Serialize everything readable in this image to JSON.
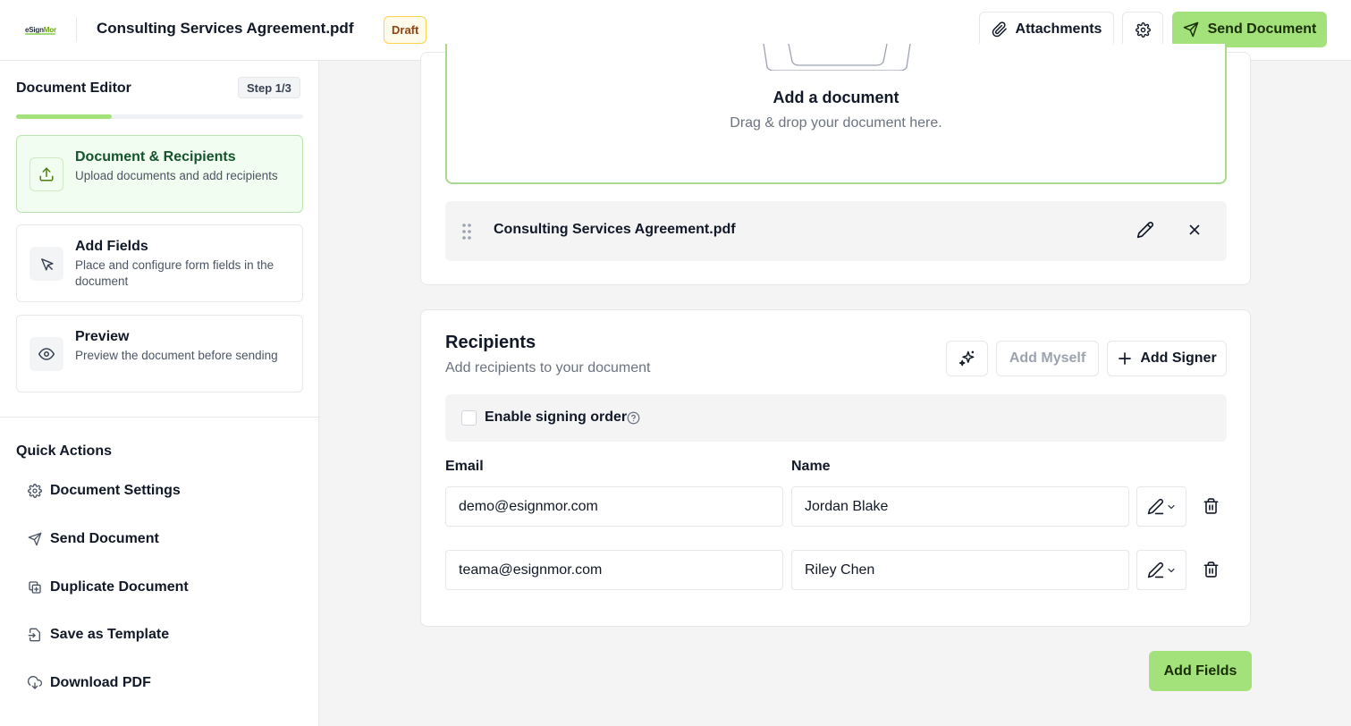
{
  "header": {
    "logo_prefix": "eSign",
    "logo_suffix": "Mor",
    "document_title": "Consulting Services Agreement.pdf",
    "status_badge": "Draft",
    "attachments_label": "Attachments",
    "send_label": "Send Document"
  },
  "sidebar": {
    "title": "Document Editor",
    "step_indicator": "Step 1/3",
    "progress_fraction": 0.333,
    "steps": [
      {
        "title": "Document & Recipients",
        "description": "Upload documents and add recipients",
        "icon": "upload-icon",
        "active": true
      },
      {
        "title": "Add Fields",
        "description": "Place and configure form fields in the document",
        "icon": "cursor-icon",
        "active": false
      },
      {
        "title": "Preview",
        "description": "Preview the document before sending",
        "icon": "eye-icon",
        "active": false
      }
    ],
    "quick_actions_title": "Quick Actions",
    "quick_actions": [
      {
        "label": "Document Settings",
        "icon": "gear-icon"
      },
      {
        "label": "Send Document",
        "icon": "send-icon"
      },
      {
        "label": "Duplicate Document",
        "icon": "duplicate-icon"
      },
      {
        "label": "Save as Template",
        "icon": "template-icon"
      },
      {
        "label": "Download PDF",
        "icon": "download-icon"
      }
    ]
  },
  "document_section": {
    "dropzone_title": "Add a document",
    "dropzone_subtitle": "Drag & drop your document here.",
    "file_name": "Consulting Services Agreement.pdf"
  },
  "recipients": {
    "title": "Recipients",
    "subtitle": "Add recipients to your document",
    "add_myself_label": "Add Myself",
    "add_signer_label": "Add Signer",
    "signing_order_label": "Enable signing order",
    "signing_order_enabled": false,
    "email_header": "Email",
    "name_header": "Name",
    "rows": [
      {
        "email": "demo@esignmor.com",
        "name": "Jordan Blake"
      },
      {
        "email": "teama@esignmor.com",
        "name": "Riley Chen"
      }
    ]
  },
  "footer": {
    "add_fields_label": "Add Fields"
  },
  "colors": {
    "accent": "#a3e27a",
    "accent_dark": "#4d7c0f",
    "draft_bg": "#fffbeb",
    "draft_text": "#92400e"
  }
}
